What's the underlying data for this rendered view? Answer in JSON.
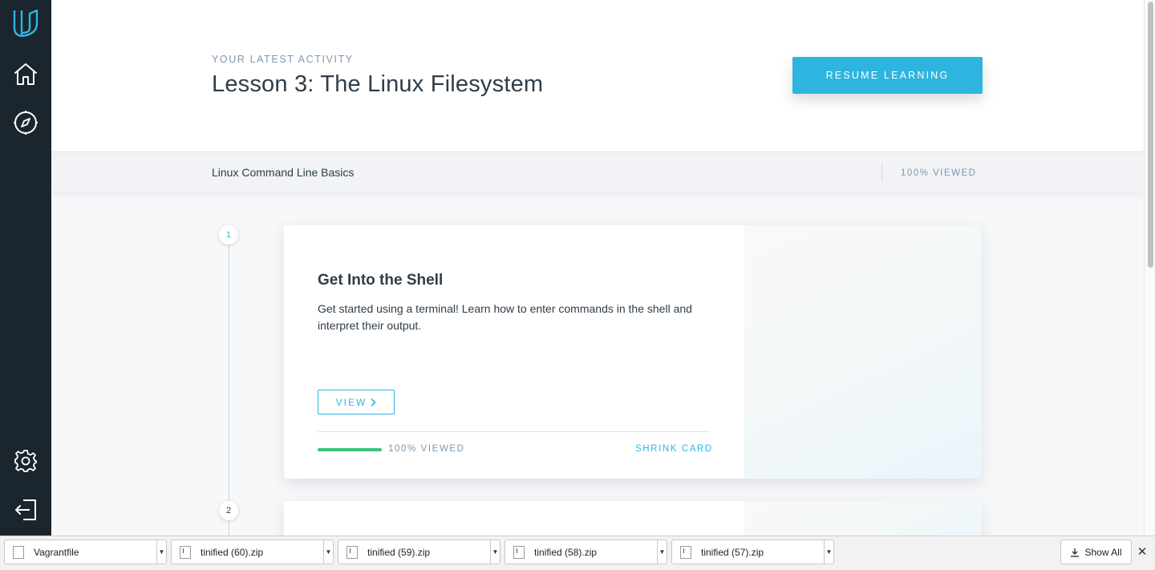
{
  "sidebar": {
    "items": [
      {
        "icon": "udacity-logo-icon"
      },
      {
        "icon": "home-icon"
      },
      {
        "icon": "compass-icon"
      },
      {
        "icon": "gear-icon"
      },
      {
        "icon": "logout-icon"
      }
    ],
    "accent": "#2eb5df"
  },
  "header": {
    "eyebrow": "YOUR LATEST ACTIVITY",
    "title": "Lesson 3: The Linux Filesystem",
    "resume_label": "RESUME LEARNING"
  },
  "course_bar": {
    "course_name": "Linux Command Line Basics",
    "viewed": "100% VIEWED"
  },
  "steps": [
    {
      "number": "1",
      "state": "active"
    },
    {
      "number": "2",
      "state": "inactive"
    }
  ],
  "cards": [
    {
      "title": "Get Into the Shell",
      "description": "Get started using a terminal! Learn how to enter commands in the shell and interpret their output.",
      "view_label": "VIEW",
      "progress": 1.0,
      "viewed_label": "100% VIEWED",
      "shrink_label": "SHRINK CARD"
    }
  ],
  "download_shelf": {
    "items": [
      {
        "name": "Vagrantfile"
      },
      {
        "name": "tinified (60).zip"
      },
      {
        "name": "tinified (59).zip"
      },
      {
        "name": "tinified (58).zip"
      },
      {
        "name": "tinified (57).zip"
      }
    ],
    "show_all_label": "Show All",
    "close_glyph": "✕"
  },
  "colors": {
    "sidebar_bg": "#1a252d",
    "brand_blue": "#2eb5df",
    "progress_green": "#3cc37a",
    "text_dark": "#2e3d49",
    "text_muted": "#7d97ad"
  }
}
